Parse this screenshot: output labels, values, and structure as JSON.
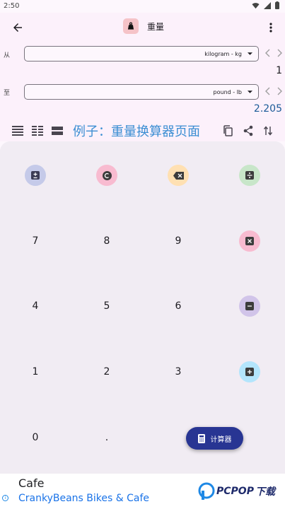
{
  "status_bar": {
    "time": "2:50"
  },
  "app_bar": {
    "title": "重量"
  },
  "from_row": {
    "label": "从",
    "unit": "kilogram - kg",
    "value": "1"
  },
  "to_row": {
    "label": "至",
    "unit": "pound - lb",
    "value": "2.205"
  },
  "example_text": "例子：重量换算器页面",
  "keypad": {
    "digits": [
      "7",
      "8",
      "9",
      "4",
      "5",
      "6",
      "1",
      "2",
      "3",
      "0",
      "."
    ],
    "fab_label": "计算器"
  },
  "colors": {
    "plus_minus_bg": "#c5cae9",
    "clear_bg": "#f8bbd0",
    "backspace_bg": "#ffe0b2",
    "divide_bg": "#c8e6c9",
    "multiply_bg": "#f8bbd0",
    "minus_bg": "#d1c4e9",
    "plus_bg": "#b3e5fc",
    "fab_bg": "#283593",
    "accent_blue": "#3b8ed3"
  },
  "ad": {
    "title": "Cafe",
    "subtitle": "CrankyBeans Bikes & Cafe",
    "info": "i"
  },
  "watermark": {
    "text": "PCPOP",
    "suffix": "下载"
  }
}
